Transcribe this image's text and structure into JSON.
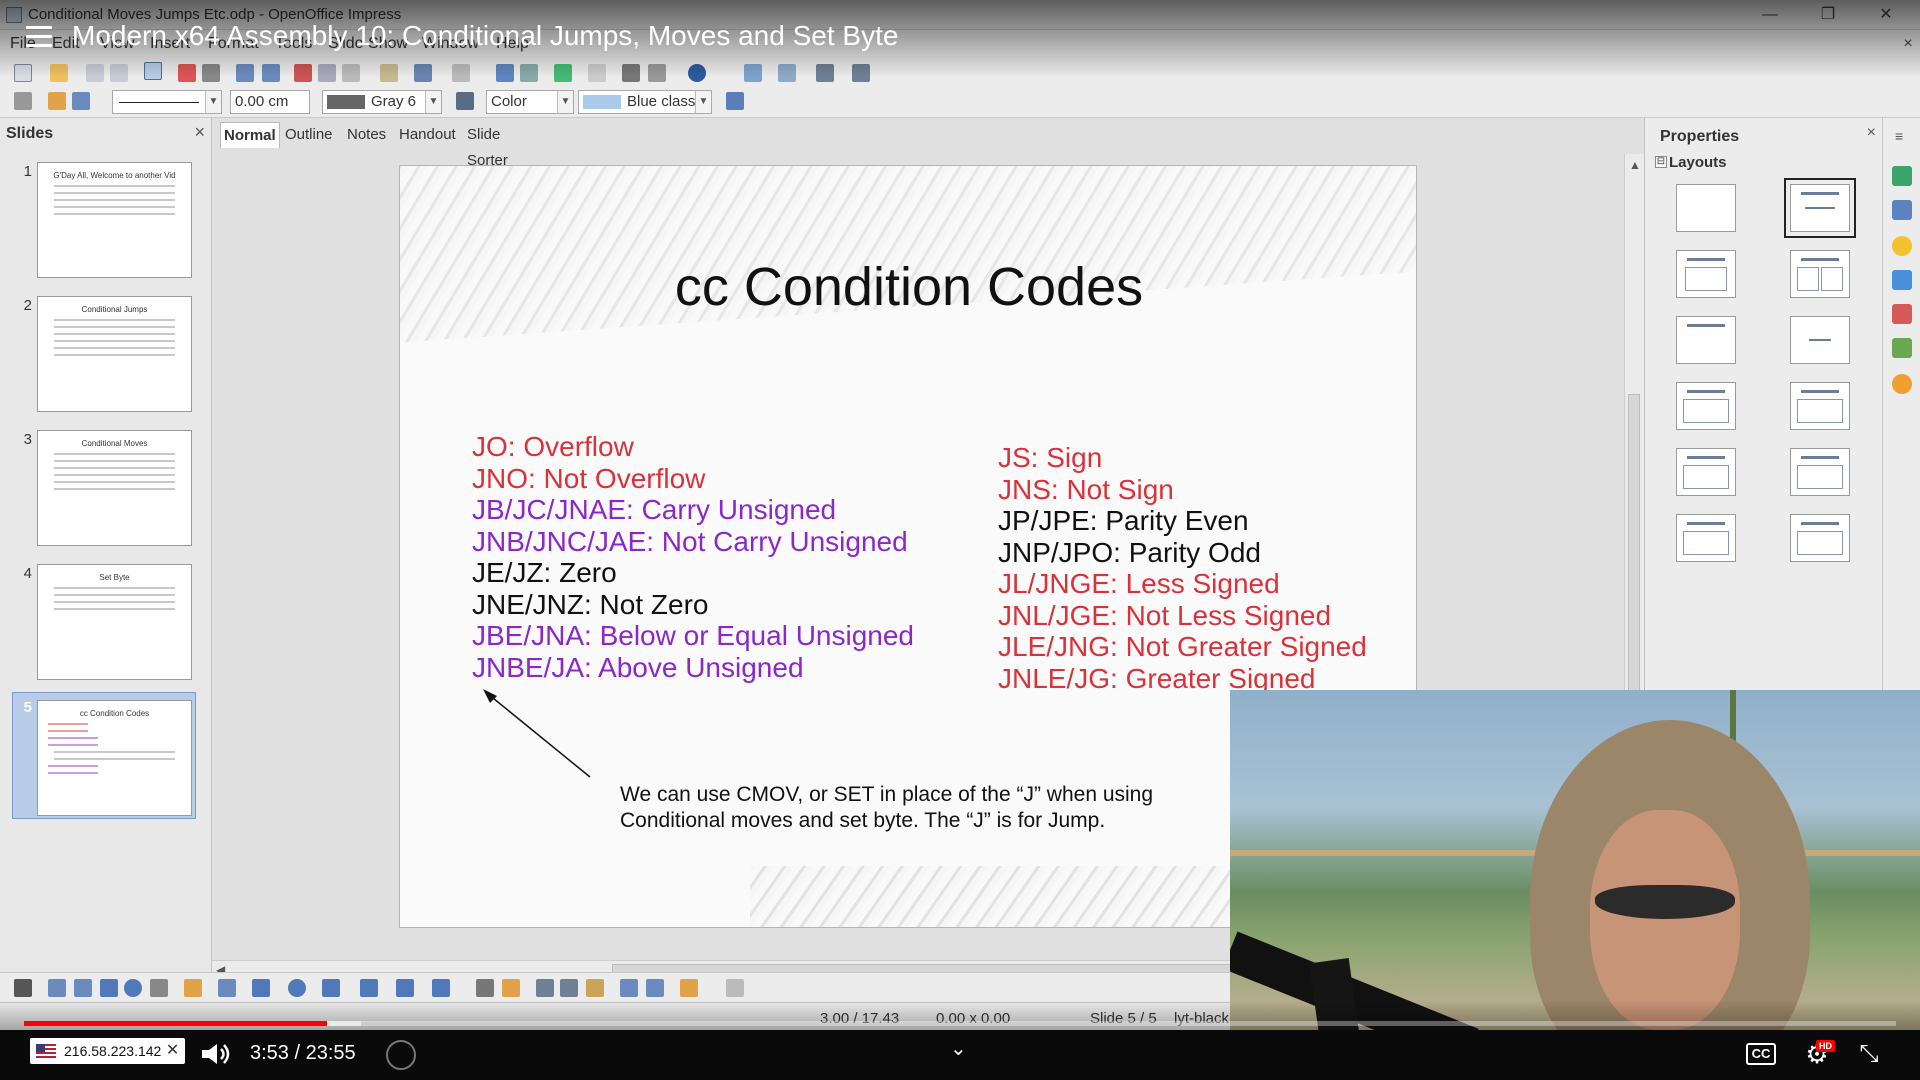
{
  "window": {
    "title": "Conditional Moves Jumps Etc.odp - OpenOffice Impress",
    "minimize": "—",
    "maximize": "❐",
    "close": "✕",
    "doc_close": "×"
  },
  "video": {
    "title": "Modern x64 Assembly 10: Conditional Jumps, Moves and Set Byte",
    "current_time": "3:53",
    "duration": "23:55",
    "time_display": "3:53 / 23:55",
    "progress_fraction": 0.162,
    "buffered_fraction": 0.18,
    "cc_label": "CC",
    "hd_label": "HD"
  },
  "menu": [
    "File",
    "Edit",
    "View",
    "Insert",
    "Format",
    "Tools",
    "Slide Show",
    "Window",
    "Help"
  ],
  "toolbar": {
    "line_width": "0.00 cm",
    "line_color": "Gray 6",
    "area_style": "Color",
    "area_fill": "Blue classic"
  },
  "slides_pane": {
    "title": "Slides",
    "close": "×",
    "slides": [
      {
        "number": "1",
        "title": "G'Day All, Welcome to another Vid"
      },
      {
        "number": "2",
        "title": "Conditional Jumps"
      },
      {
        "number": "3",
        "title": "Conditional Moves"
      },
      {
        "number": "4",
        "title": "Set Byte"
      },
      {
        "number": "5",
        "title": "cc Condition Codes"
      }
    ]
  },
  "view_tabs": [
    "Normal",
    "Outline",
    "Notes",
    "Handout",
    "Slide Sorter"
  ],
  "slide": {
    "title": "cc Condition Codes",
    "left_column": [
      {
        "text": "JO: Overflow",
        "color": "#d9323a"
      },
      {
        "text": "JNO: Not Overflow",
        "color": "#d9323a"
      },
      {
        "text": "JB/JC/JNAE: Carry Unsigned",
        "color": "#8a28c8"
      },
      {
        "text": "JNB/JNC/JAE: Not Carry Unsigned",
        "color": "#8a28c8"
      },
      {
        "text": "JE/JZ: Zero",
        "color": "#111111"
      },
      {
        "text": "JNE/JNZ: Not Zero",
        "color": "#111111"
      },
      {
        "text": "JBE/JNA: Below or Equal Unsigned",
        "color": "#8a28c8"
      },
      {
        "text": "JNBE/JA: Above Unsigned",
        "color": "#8a28c8"
      }
    ],
    "right_column": [
      {
        "text": "JS: Sign",
        "color": "#d9323a"
      },
      {
        "text": "JNS: Not Sign",
        "color": "#d9323a"
      },
      {
        "text": "JP/JPE: Parity Even",
        "color": "#111111"
      },
      {
        "text": "JNP/JPO: Parity Odd",
        "color": "#111111"
      },
      {
        "text": "JL/JNGE: Less Signed",
        "color": "#d9323a"
      },
      {
        "text": "JNL/JGE: Not Less Signed",
        "color": "#d9323a"
      },
      {
        "text": "JLE/JNG: Not Greater Signed",
        "color": "#d9323a"
      },
      {
        "text": "JNLE/JG: Greater Signed",
        "color": "#d9323a"
      }
    ],
    "note_line1": "We can use CMOV, or SET in place of the “J” when using",
    "note_line2": "Conditional moves and set byte. The “J” is for Jump."
  },
  "properties": {
    "title": "Properties",
    "close": "×",
    "section": "Layouts",
    "toggle": "⊟"
  },
  "status": {
    "position": "3.00 / 17.43",
    "size": "0.00 x 0.00",
    "slide": "Slide 5 / 5",
    "master": "lyt-black"
  },
  "taskbar": {
    "ip_address": "216.58.223.142",
    "ip_close": "✕",
    "chevron": "⌄"
  },
  "icons": {
    "hamburger": "menu-icon",
    "volume": "volume-icon",
    "settings": "settings-icon",
    "fullscreen": "exit-fullscreen-icon"
  }
}
